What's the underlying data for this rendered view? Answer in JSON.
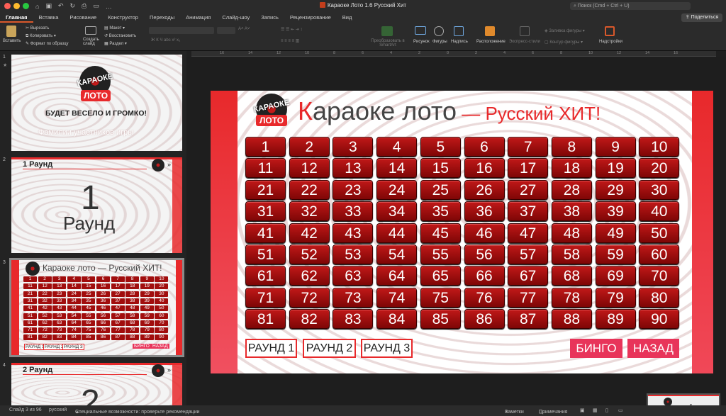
{
  "window": {
    "title": "Караоке Лото 1.6 Русский Хит",
    "search_placeholder": "Поиск (Cmd + Ctrl + U)",
    "share_label": "Поделиться"
  },
  "menu": {
    "tabs": [
      "Главная",
      "Вставка",
      "Рисование",
      "Конструктор",
      "Переходы",
      "Анимация",
      "Слайд-шоу",
      "Запись",
      "Рецензирование",
      "Вид"
    ]
  },
  "ribbon": {
    "paste": "Вставить",
    "cut": "Вырезать",
    "copy": "Копировать",
    "format_painter": "Формат по образцу",
    "new_slide": "Создать слайд",
    "layout": "Макет",
    "reset": "Восстановить",
    "section": "Раздел",
    "smartart": "Преобразовать в SmartArt",
    "picture": "Рисунок",
    "shapes": "Фигуры",
    "textbox": "Надпись",
    "arrange": "Расположение",
    "quick_styles": "Экспресс-стили",
    "shape_fill": "Заливка фигуры",
    "shape_outline": "Контур фигуры",
    "addins": "Надстройки"
  },
  "ruler": {
    "ticks": [
      "16",
      "14",
      "12",
      "10",
      "8",
      "6",
      "4",
      "2",
      "0",
      "2",
      "4",
      "6",
      "8",
      "10",
      "12",
      "14",
      "16"
    ]
  },
  "thumbnails": [
    {
      "num": "1",
      "logo_top": "КАРАОКЕ",
      "logo_bottom": "ЛОТО",
      "tagline": "БУДЕТ ВЕСЕЛО И ГРОМКО!",
      "subtitle": "Фамилии участников игры"
    },
    {
      "num": "2",
      "header": "1 Раунд",
      "big_number": "1",
      "big_word": "Раунд"
    },
    {
      "num": "3",
      "title": "Караоке лото — Русский ХИТ!",
      "buttons": [
        "РАУНД 1",
        "РАУНД 2",
        "РАУНД 3"
      ],
      "actions": [
        "БИНГО",
        "НАЗАД"
      ]
    },
    {
      "num": "4",
      "header": "2 Раунд",
      "big_number": "2"
    }
  ],
  "slide": {
    "logo_top": "КАРАОКЕ",
    "logo_bottom": "ЛОТО",
    "title_first": "К",
    "title_rest": "араоке лото",
    "title_dash": " — ",
    "title_sub": "Русский ХИТ!",
    "numbers": [
      "1",
      "2",
      "3",
      "4",
      "5",
      "6",
      "7",
      "8",
      "9",
      "10",
      "11",
      "12",
      "13",
      "14",
      "15",
      "16",
      "17",
      "18",
      "19",
      "20",
      "21",
      "22",
      "23",
      "24",
      "25",
      "26",
      "27",
      "28",
      "29",
      "30",
      "31",
      "32",
      "33",
      "34",
      "35",
      "36",
      "37",
      "38",
      "39",
      "40",
      "41",
      "42",
      "43",
      "44",
      "45",
      "46",
      "47",
      "48",
      "49",
      "50",
      "51",
      "52",
      "53",
      "54",
      "55",
      "56",
      "57",
      "58",
      "59",
      "60",
      "61",
      "62",
      "63",
      "64",
      "65",
      "66",
      "67",
      "68",
      "69",
      "70",
      "71",
      "72",
      "73",
      "74",
      "75",
      "76",
      "77",
      "78",
      "79",
      "80",
      "81",
      "82",
      "83",
      "84",
      "85",
      "86",
      "87",
      "88",
      "89",
      "90"
    ],
    "round_buttons": [
      "РАУНД 1",
      "РАУНД 2",
      "РАУНД 3"
    ],
    "bingo": "БИНГО",
    "back": "НАЗАД"
  },
  "status": {
    "slide_info": "Слайд 3 из 96",
    "language": "русский",
    "accessibility": "Специальные возможности: проверьте рекомендации",
    "notes": "Заметки",
    "comments": "Примечания"
  },
  "colors": {
    "accent": "#e8292b",
    "cell": "#a10d0d",
    "action": "#e8345a"
  }
}
